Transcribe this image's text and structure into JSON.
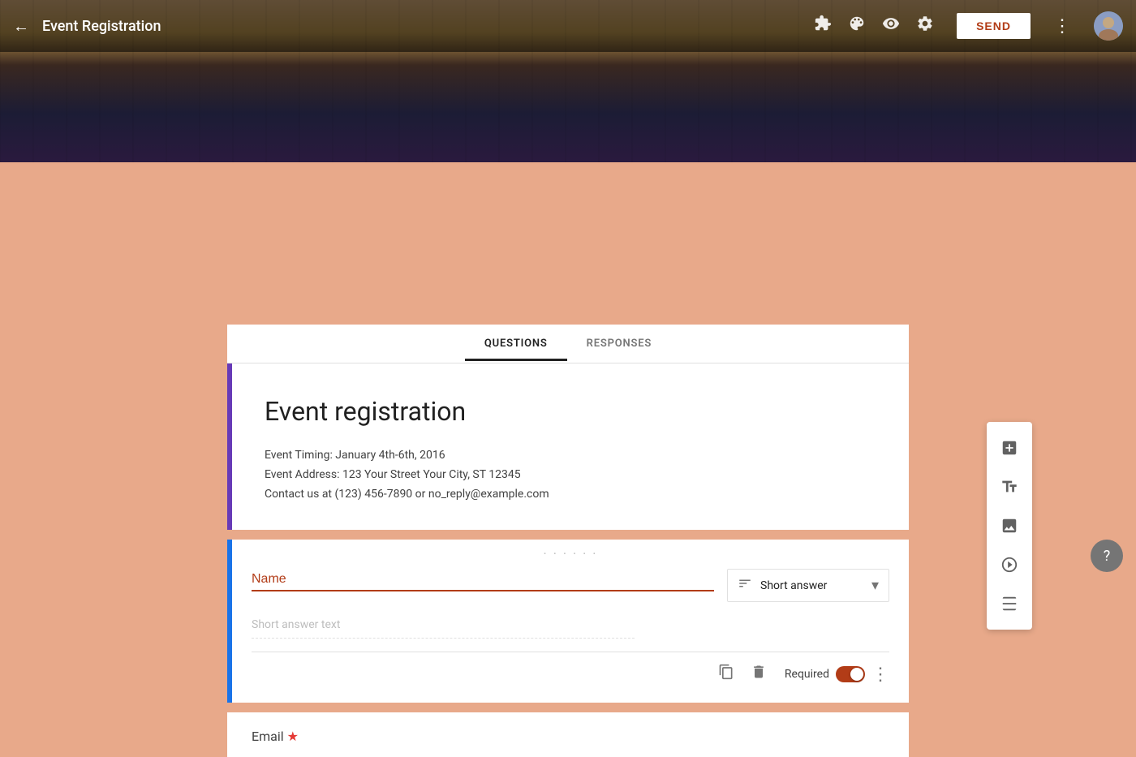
{
  "header": {
    "back_label": "←",
    "title": "Event Registration",
    "send_label": "SEND",
    "icons": {
      "puzzle": "⧉",
      "palette": "🎨",
      "eye": "◎",
      "settings": "⚙"
    }
  },
  "tabs": [
    {
      "id": "questions",
      "label": "QUESTIONS",
      "active": true
    },
    {
      "id": "responses",
      "label": "RESPONSES",
      "active": false
    }
  ],
  "form": {
    "title": "Event registration",
    "description_line1": "Event Timing: January 4th-6th, 2016",
    "description_line2": "Event Address: 123 Your Street Your City, ST 12345",
    "description_line3": "Contact us at (123) 456-7890 or no_reply@example.com"
  },
  "question_card": {
    "drag_dots": "⠿",
    "question_label": "Name",
    "answer_type": "Short answer",
    "answer_placeholder": "Short answer text",
    "required_label": "Required",
    "footer": {
      "copy_label": "copy",
      "delete_label": "delete",
      "more_label": "more"
    }
  },
  "email_card": {
    "label": "Email",
    "required_star": "★"
  },
  "sidebar": {
    "add_label": "+",
    "title_label": "Tt",
    "image_label": "🖼",
    "video_label": "▶",
    "section_label": "▬"
  },
  "help": {
    "label": "?"
  }
}
